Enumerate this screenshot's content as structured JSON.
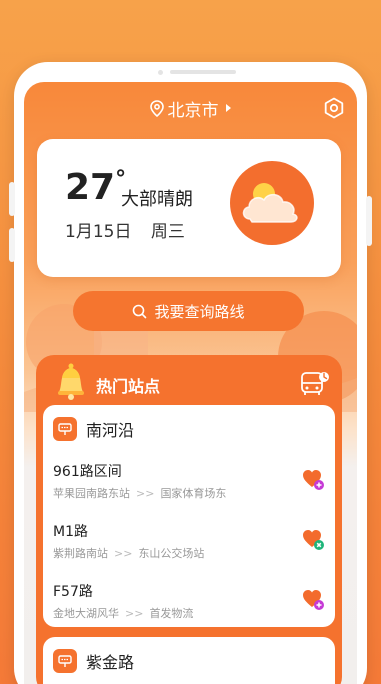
{
  "location": {
    "city": "北京市"
  },
  "weather": {
    "temperature": "27",
    "degree_symbol": "°",
    "condition": "大部晴朗",
    "date": "1月15日",
    "weekday": "周三"
  },
  "route_search": {
    "label": "我要查询路线"
  },
  "hot_stations": {
    "title": "热门站点",
    "stations": [
      {
        "name": "南河沿",
        "routes": [
          {
            "name": "961路区间",
            "from": "苹果园南路东站",
            "arrow": ">>",
            "to": "国家体育场东",
            "badge": "plus"
          },
          {
            "name": "M1路",
            "from": "紫荆路南站",
            "arrow": ">>",
            "to": "东山公交场站",
            "badge": "close"
          },
          {
            "name": "F57路",
            "from": "金地大湖风华",
            "arrow": ">>",
            "to": "首发物流",
            "badge": "plus"
          }
        ]
      },
      {
        "name": "紫金路",
        "routes": []
      }
    ]
  },
  "colors": {
    "accent": "#f5722e",
    "accent_light": "#f8883a",
    "badge_purple": "#c53ad6",
    "badge_green": "#1fb57a"
  }
}
